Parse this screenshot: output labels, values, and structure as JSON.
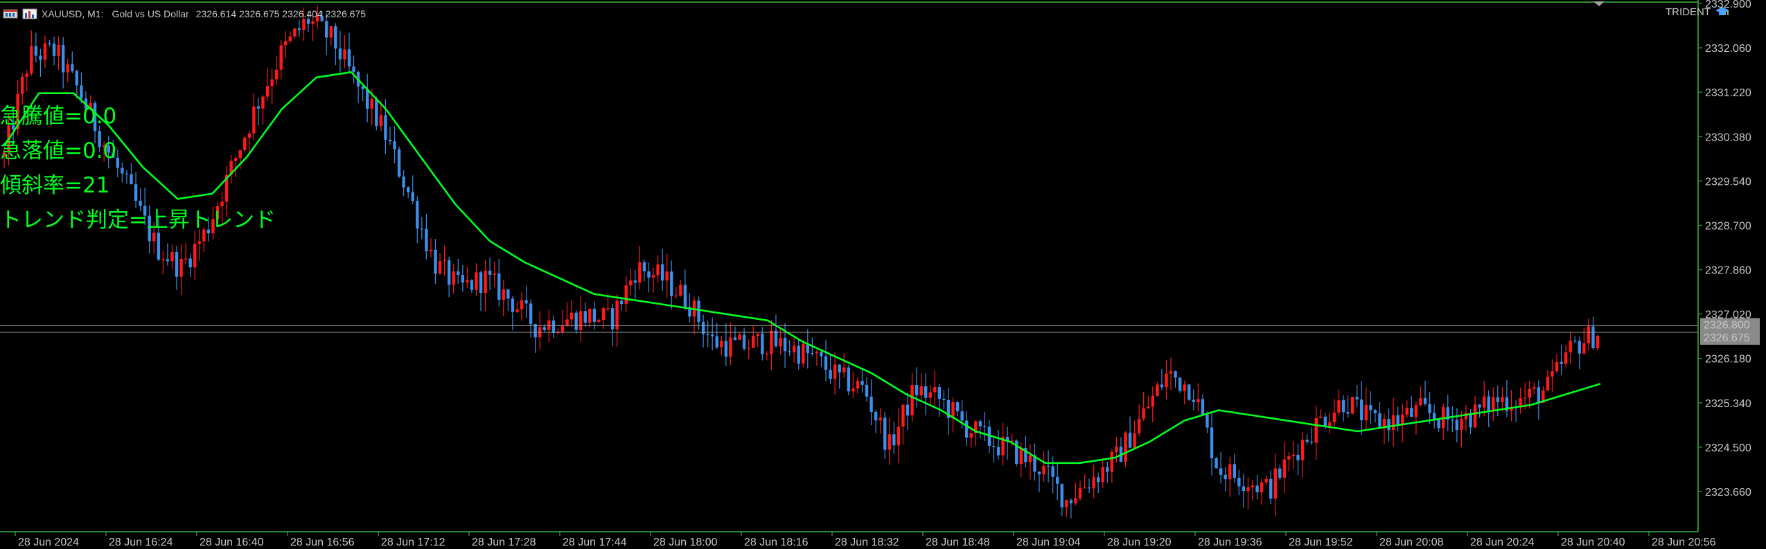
{
  "window": {
    "symbol": "XAUUSD, M1:",
    "description": "Gold vs US Dollar",
    "ohlc": "2326.614 2326.675 2326.404 2326.675"
  },
  "expert": {
    "name": "TRIDENT",
    "icon": "graduation-cap-icon"
  },
  "indicator_text": [
    "急騰値=0.0",
    "急落値=0.0",
    "傾斜率=21",
    "トレンド判定=上昇トレンド"
  ],
  "colors": {
    "background": "#000000",
    "bull": "#ff1a1a",
    "bear": "#3c8ee8",
    "ma_line": "#00ff20",
    "text": "#c8c8c8",
    "grid_border": "#2e8b2e",
    "indicator_text": "#00ff20"
  },
  "chart_data": {
    "type": "candlestick",
    "title": "XAUUSD, M1: Gold vs US Dollar",
    "ylim": [
      2322.9,
      2332.9
    ],
    "y_ticks": [
      "2332.900",
      "2332.060",
      "2331.220",
      "2330.380",
      "2329.540",
      "2328.700",
      "2327.860",
      "2327.020",
      "2326.180",
      "2325.340",
      "2324.500",
      "2323.660"
    ],
    "x_ticks": [
      "28 Jun 2024",
      "28 Jun 16:24",
      "28 Jun 16:40",
      "28 Jun 16:56",
      "28 Jun 17:12",
      "28 Jun 17:28",
      "28 Jun 17:44",
      "28 Jun 18:00",
      "28 Jun 18:16",
      "28 Jun 18:32",
      "28 Jun 18:48",
      "28 Jun 19:04",
      "28 Jun 19:20",
      "28 Jun 19:36",
      "28 Jun 19:52",
      "28 Jun 20:08",
      "28 Jun 20:24",
      "28 Jun 20:40",
      "28 Jun 20:56"
    ],
    "price_lines": [
      {
        "label": "2326.800",
        "value": 2326.8
      },
      {
        "label": "2326.675",
        "value": 2326.675
      }
    ],
    "close_path": [
      2330.0,
      2331.9,
      2332.0,
      2331.2,
      2330.2,
      2329.3,
      2328.3,
      2327.9,
      2328.6,
      2329.8,
      2331.0,
      2332.0,
      2332.6,
      2332.2,
      2331.3,
      2330.5,
      2329.3,
      2328.0,
      2327.5,
      2327.7,
      2327.3,
      2326.8,
      2326.9,
      2327.0,
      2326.9,
      2327.9,
      2327.7,
      2327.3,
      2326.5,
      2326.4,
      2326.5,
      2326.4,
      2326.2,
      2325.8,
      2325.6,
      2324.5,
      2325.6,
      2325.4,
      2324.9,
      2324.6,
      2324.4,
      2324.1,
      2323.5,
      2323.9,
      2324.3,
      2325.1,
      2325.9,
      2325.6,
      2324.1,
      2323.9,
      2323.7,
      2324.4,
      2325.0,
      2325.4,
      2325.0,
      2325.0,
      2325.2,
      2325.0,
      2325.1,
      2325.4,
      2325.4,
      2325.6,
      2326.4,
      2326.67
    ],
    "ma_path": [
      2330.2,
      2331.2,
      2331.2,
      2330.6,
      2329.8,
      2329.2,
      2329.3,
      2330.0,
      2330.9,
      2331.5,
      2331.6,
      2330.9,
      2330.0,
      2329.1,
      2328.4,
      2328.0,
      2327.7,
      2327.4,
      2327.3,
      2327.2,
      2327.1,
      2327.0,
      2326.9,
      2326.5,
      2326.2,
      2325.9,
      2325.5,
      2325.2,
      2324.8,
      2324.6,
      2324.2,
      2324.2,
      2324.3,
      2324.6,
      2325.0,
      2325.2,
      2325.1,
      2325.0,
      2324.9,
      2324.8,
      2324.9,
      2325.0,
      2325.1,
      2325.2,
      2325.3,
      2325.5,
      2325.7
    ],
    "legend": "none",
    "grid": false
  }
}
